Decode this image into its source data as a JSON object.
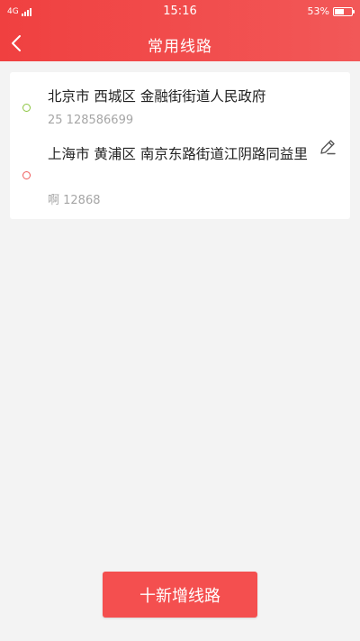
{
  "status_bar": {
    "network": "4G",
    "time": "15:16",
    "battery": "53%",
    "battery_level": 0.53
  },
  "header": {
    "title": "常用线路",
    "back_icon": "chevron-left-icon"
  },
  "route": {
    "origin": {
      "address": "北京市 西城区 金融街街道人民政府",
      "contact": "25 128586699",
      "dot_color": "#8cc540"
    },
    "destination": {
      "address": "上海市 黄浦区 南京东路街道江阴路同益里",
      "contact": "啊 12868",
      "dot_color": "#ef5a5a"
    },
    "edit_icon": "pencil-icon"
  },
  "add_route_button": {
    "label": "十新增线路"
  },
  "colors": {
    "accent": "#f04040",
    "background": "#f3f3f3"
  }
}
